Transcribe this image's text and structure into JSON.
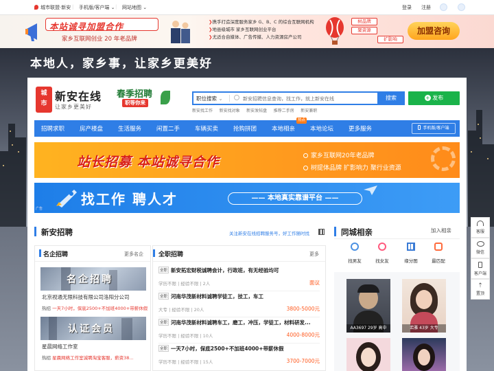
{
  "topbar": {
    "site_name": "城市联盟·新安",
    "mobile": "手机版/客户端",
    "sitemap": "网站地图",
    "login": "登录",
    "register": "注册"
  },
  "ad_banner": {
    "title": "本站诚寻加盟合作",
    "subtitle": "家乡互联网创业 20 年老品牌",
    "points": [
      "携手打造深度服务家乡 G、B、C 的综合互联网机构",
      "地县级城市 家乡互联网创业平台",
      "尤适合自媒体、广告传媒、人力资源房产公司"
    ],
    "tags": [
      "树品牌",
      "聚资源",
      "扩影响"
    ],
    "cta": "加盟咨询"
  },
  "slogan": "本地人，家乡事，让家乡更美好",
  "logo": {
    "badge_top": "城",
    "badge_bottom": "市",
    "name": "新安在线",
    "tagline": "让家乡更美好"
  },
  "promo_badge": {
    "title": "春季招聘",
    "sub": "职等你来"
  },
  "search": {
    "category": "职位搜索",
    "placeholder": "新安招聘信息查询，找工作，就上新安在线",
    "button": "搜索",
    "post_button": "发布",
    "hot_links": [
      "新安找工作",
      "新安找对象",
      "新安发帖盘",
      "推荐二手房",
      "新安兼职"
    ]
  },
  "nav": {
    "items": [
      "招聘求职",
      "房产楼盘",
      "生活服务",
      "闲置二手",
      "车辆买卖",
      "抢购拼团",
      "本地相亲",
      "本地论坛",
      "更多服务"
    ],
    "hot_badge": "热点",
    "mobile": "手机版/客户端"
  },
  "banner1": {
    "title": "站长招募  本站诚寻合作",
    "line1": "家乡互联网20年老品牌",
    "line2": "树提体品牌  扩影响力  聚行业资源"
  },
  "banner2": {
    "title": "找工作  聘人才",
    "sub": "本地真实靠谱平台",
    "corner": "广告"
  },
  "recruit": {
    "title": "新安招聘",
    "notice": "关注新安在线招聘服务号，好工作随时找",
    "famous": {
      "title": "名企招聘",
      "more": "更多名企",
      "img1_text": "名企招聘",
      "company1": "北京视通无限科技有限公司洛阳分公司",
      "hire1": "热招",
      "hire1_text": "一天7小时，保底2500+不加班4000+带薪休假",
      "img2_text": "认证会员",
      "company2": "星晨网络工作室",
      "hire2": "热招",
      "hire2_text": "星晨网络工作室诚聘淘宝客服，薪资38..."
    },
    "fulltime": {
      "title": "全职招聘",
      "more": "更多",
      "jobs": [
        {
          "tag": "全职",
          "title": "新安拓宏财税诚聘会计，行政班，有无经验均可",
          "meta": "学历不限 | 经验不限 | 2人",
          "salary": "面议"
        },
        {
          "tag": "全职",
          "title": "河南华茂新材料诚聘学徒工，技工，车工",
          "meta": "大专 | 经验不限 | 20人",
          "salary": "3800-5000元"
        },
        {
          "tag": "全职",
          "title": "河南华茂新材料诚聘车工，磨工，冲压，学徒工，材料研发...",
          "meta": "学历不限 | 经验不限 | 10人",
          "salary": "4000-8000元"
        },
        {
          "tag": "全职",
          "title": "一天7小时，保底2500+不加班4000+带薪休假",
          "meta": "学历不限 | 经验不限 | 15人",
          "salary": "3700-7000元"
        }
      ]
    }
  },
  "dating": {
    "title": "同城相亲",
    "join": "加入相亲",
    "icons": [
      {
        "label": "找男友",
        "color": "#4a90e2",
        "icon": "male-icon"
      },
      {
        "label": "找女友",
        "color": "#ff5a7e",
        "icon": "female-icon"
      },
      {
        "label": "缘分图",
        "color": "#3a7bd5",
        "icon": "grid-icon"
      },
      {
        "label": "最匹配",
        "color": "#ff6b3d",
        "icon": "heart-match-icon"
      }
    ],
    "profiles": [
      {
        "caption": "AA3697 29岁 高中"
      },
      {
        "caption": "若雅 43岁 大专"
      }
    ]
  },
  "side_tools": [
    "客服",
    "微信",
    "客户端",
    "置顶"
  ]
}
